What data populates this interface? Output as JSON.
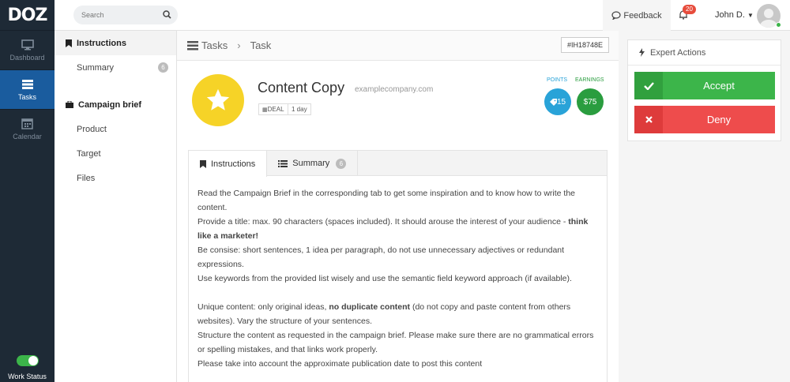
{
  "app": {
    "logo": "DOZ"
  },
  "rail": {
    "items": [
      {
        "label": "Dashboard",
        "icon": "monitor-icon"
      },
      {
        "label": "Tasks",
        "icon": "stack-icon"
      },
      {
        "label": "Calendar",
        "icon": "calendar-icon"
      }
    ],
    "work_status_label": "Work Status"
  },
  "topbar": {
    "search_placeholder": "Search",
    "feedback_label": "Feedback",
    "notifications_count": "20",
    "user_name": "John D."
  },
  "subnav": {
    "instructions_label": "Instructions",
    "summary_label": "Summary",
    "summary_count": "6",
    "campaign_label": "Campaign brief",
    "items": [
      "Product",
      "Target",
      "Files"
    ]
  },
  "main": {
    "breadcrumb": [
      "Tasks",
      "Task"
    ],
    "task_id": "#IH18748E",
    "title": "Content Copy",
    "company": "examplecompany.com",
    "tag_deal": "DEAL",
    "tag_duration": "1 day",
    "points_label": "POINTS",
    "earnings_label": "EARNINGS",
    "points_value": "15",
    "earnings_value": "$75",
    "tabs": [
      {
        "label": "Instructions",
        "icon": "bookmark-icon"
      },
      {
        "label": "Summary",
        "icon": "list-icon",
        "count": "6"
      }
    ],
    "content": {
      "p1": "Read the Campaign Brief in the corresponding tab to get some inspiration and to know how to write the content.",
      "p2_a": "Provide a title: max. 90 characters (spaces included). It should arouse the interest of your audience - ",
      "p2_b": "think like a marketer!",
      "p3": "Be consise: short sentences, 1 idea per paragraph, do not use unnecessary adjectives or redundant expressions.",
      "p4": "Use keywords from the provided list wisely and use the semantic field keyword approach (if available).",
      "p5_a": "Unique content: only original ideas, ",
      "p5_b": "no duplicate content",
      "p5_c": " (do not copy and paste content from others websites). Vary the structure of your sentences.",
      "p6": "Structure the content as requested in the campaign brief. Please make sure there are no grammatical errors or spelling mistakes, and that links work properly.",
      "p7": "Please take into account the approximate publication date to post this content"
    }
  },
  "expert": {
    "title": "Expert Actions",
    "accept_label": "Accept",
    "deny_label": "Deny"
  },
  "colors": {
    "rail_bg": "#1e2a36",
    "rail_active": "#1a5c9e",
    "accept": "#3cb54a",
    "deny": "#ee4c4c",
    "points": "#29a3d8",
    "earnings": "#2a9d3f",
    "star_badge": "#f6d327"
  }
}
